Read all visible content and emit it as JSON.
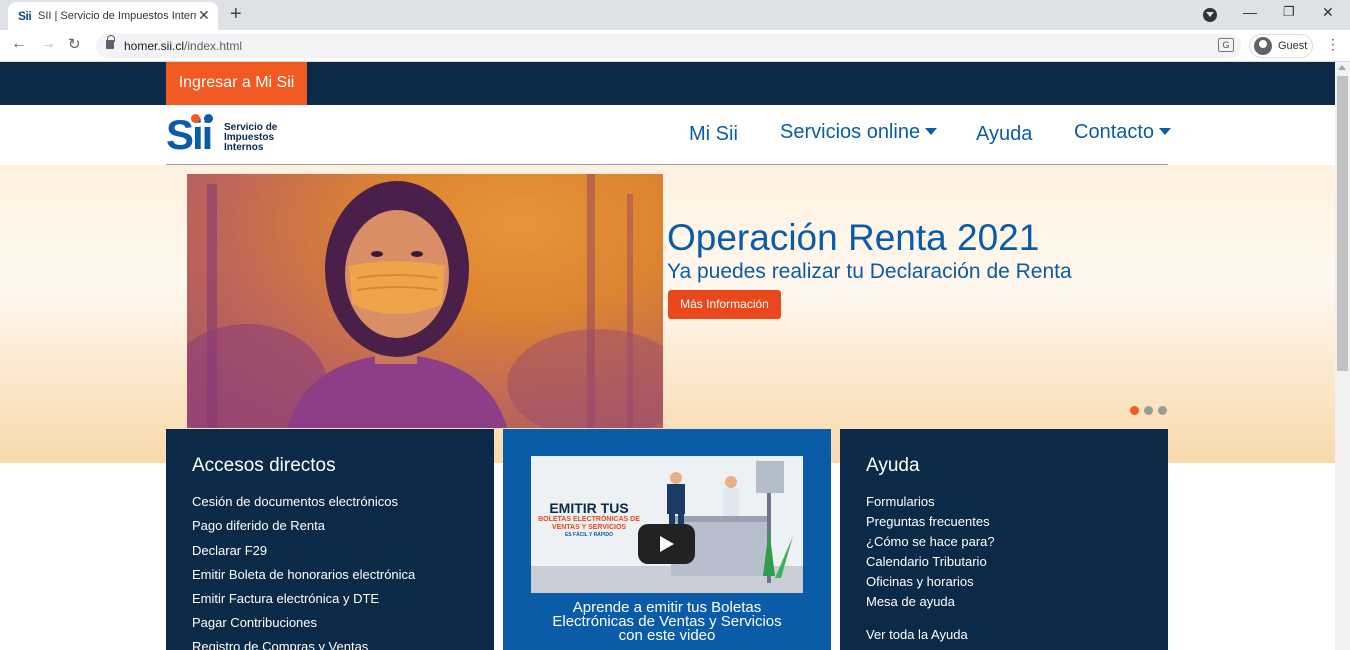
{
  "browser": {
    "tab_title": "SII | Servicio de Impuestos Internos",
    "tab_favicon": "Sii",
    "url_host": "homer.sii.cl",
    "url_path": "/index.html",
    "profile_label": "Guest",
    "translate_glyph": "G"
  },
  "topbar": {
    "login_label": "Ingresar a Mi Sii"
  },
  "logo": {
    "mark": "Sii",
    "line1": "Servicio de",
    "line2": "Impuestos",
    "line3": "Internos"
  },
  "nav": {
    "mi_sii": "Mi Sii",
    "servicios": "Servicios online",
    "ayuda": "Ayuda",
    "contacto": "Contacto"
  },
  "hero": {
    "title": "Operación Renta 2021",
    "subtitle": "Ya puedes realizar tu Declaración de Renta",
    "button": "Más Información",
    "dot_active_color": "#f15a22",
    "dot_inactive_color": "#9b9b9b"
  },
  "accesos": {
    "title": "Accesos directos",
    "links": [
      "Cesión de documentos electrónicos",
      "Pago diferido de Renta",
      "Declarar F29",
      "Emitir Boleta de honorarios electrónica",
      "Emitir Factura electrónica y DTE",
      "Pagar Contribuciones",
      "Registro de Compras y Ventas"
    ]
  },
  "video": {
    "thumb_title": "EMITIR TUS",
    "thumb_sub": "BOLETAS ELECTRÓNICAS DE VENTAS Y SERVICIOS",
    "thumb_sub2": "ES FÁCIL Y RÁPIDO",
    "caption_line1": "Aprende a emitir tus  Boletas",
    "caption_line2": "Electrónicas de Ventas y Servicios",
    "caption_line3": "con este video"
  },
  "ayuda": {
    "title": "Ayuda",
    "links": [
      "Formularios",
      "Preguntas frecuentes",
      "¿Cómo se hace para?",
      "Calendario Tributario",
      "Oficinas y horarios",
      "Mesa de ayuda"
    ],
    "see_all": "Ver toda la Ayuda"
  },
  "colors": {
    "brand_blue": "#0b5ca8",
    "navy": "#0b2a48",
    "orange": "#f15a22"
  }
}
